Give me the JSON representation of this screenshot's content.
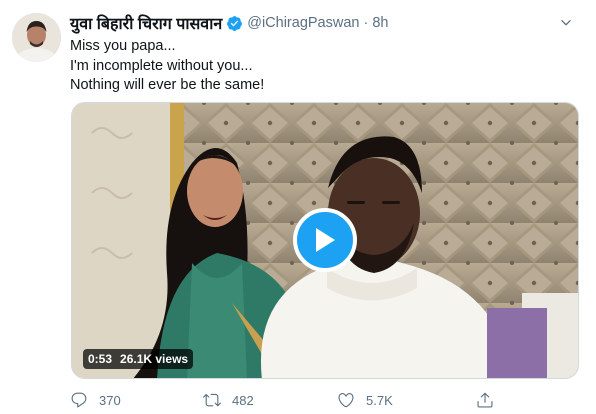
{
  "tweet": {
    "display_name": "युवा बिहारी चिराग पासवान",
    "handle": "@iChiragPaswan",
    "separator": "·",
    "time": "8h",
    "text_lines": [
      "Miss you papa...",
      "I'm incomplete without you...",
      "Nothing will ever be the same!"
    ]
  },
  "media": {
    "type": "video",
    "duration": "0:53",
    "views": "26.1K views"
  },
  "actions": {
    "reply_count": "370",
    "retweet_count": "482",
    "like_count": "5.7K"
  },
  "colors": {
    "accent": "#1da1f2",
    "muted_text": "#5b7083",
    "primary_text": "#0f1419"
  },
  "icons": [
    "caret-down-icon",
    "verified-badge-icon",
    "play-icon",
    "reply-icon",
    "retweet-icon",
    "like-icon",
    "share-icon"
  ]
}
